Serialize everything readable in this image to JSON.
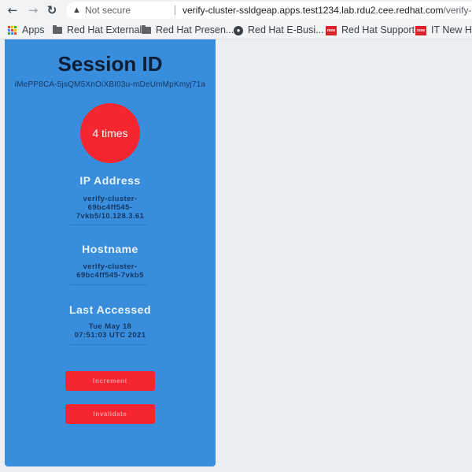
{
  "browser": {
    "nav": {
      "back_icon": "←",
      "forward_icon": "→",
      "reload_icon": "↻"
    },
    "omnibox": {
      "security_icon": "▲",
      "security_label": "Not secure",
      "url_host": "verify-cluster-ssldgeap.apps.test1234.lab.rdu2.cee.redhat.com",
      "url_path": "/verify-cluster/counter"
    },
    "bookmarks": [
      {
        "label": "Apps",
        "icon": "apps-grid"
      },
      {
        "label": "Red Hat External",
        "icon": "folder"
      },
      {
        "label": "Red Hat Presen...",
        "icon": "folder"
      },
      {
        "label": "Red Hat E-Busi...",
        "icon": "globe"
      },
      {
        "label": "Red Hat Support",
        "icon": "servicenow"
      },
      {
        "label": "IT New Hir",
        "icon": "servicenow"
      }
    ]
  },
  "page": {
    "title": "Session ID",
    "session_id": "iMePP8CA-5jsQM5XnOiXBI03u-mDeUmMpKmyj71a",
    "counter_label": "4 times",
    "ip_address": {
      "heading": "IP Address",
      "lines": [
        "verify-cluster-",
        "69bc4ff545-",
        "7vkb5/10.128.3.61"
      ]
    },
    "hostname": {
      "heading": "Hostname",
      "lines": [
        "verify-cluster-",
        "69bc4ff545-7vkb5"
      ]
    },
    "last_accessed": {
      "heading": "Last Accessed",
      "lines": [
        "Tue May 18",
        "07:51:03 UTC 2021"
      ]
    },
    "buttons": {
      "increment": "Increment",
      "invalidate": "Invalidate"
    }
  },
  "colors": {
    "panel": "#388ddd",
    "accent_red": "#f5262f",
    "page_bg": "#eceff1"
  }
}
